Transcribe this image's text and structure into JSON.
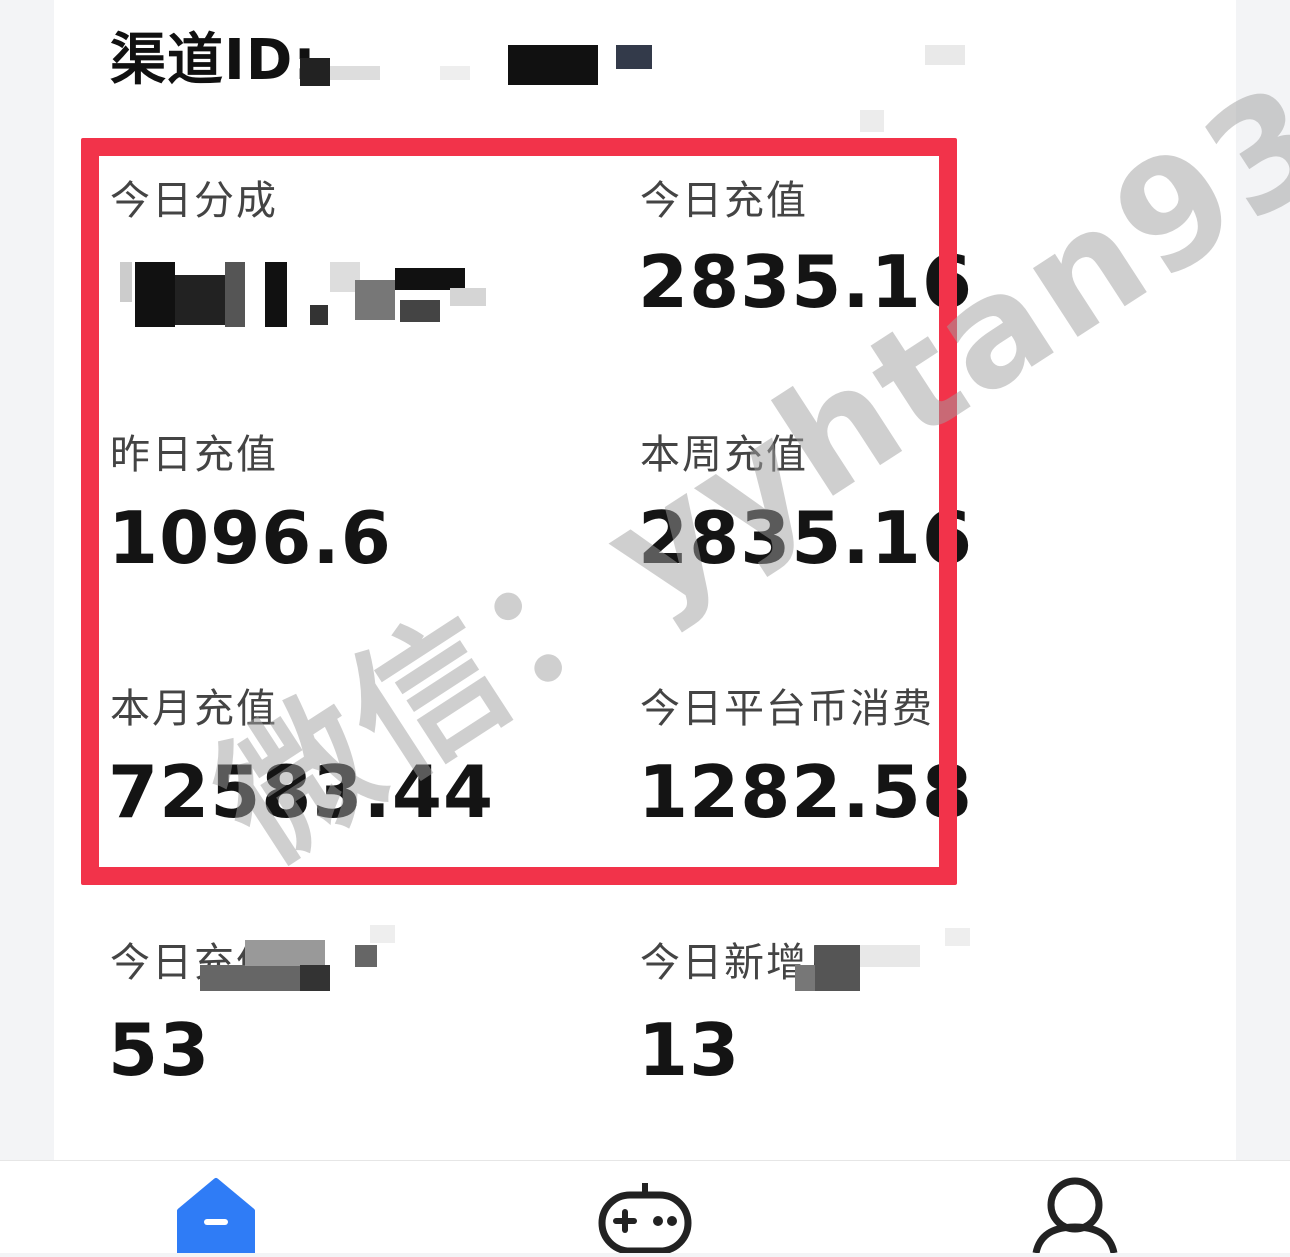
{
  "header": {
    "channel_label": "渠道ID:"
  },
  "stats": {
    "today_share_label": "今日分成",
    "today_recharge_label": "今日充值",
    "today_recharge_value": "2835.16",
    "yesterday_recharge_label": "昨日充值",
    "yesterday_recharge_value": "1096.6",
    "week_recharge_label": "本周充值",
    "week_recharge_value": "2835.16",
    "month_recharge_label": "本月充值",
    "month_recharge_value": "72583.44",
    "today_coin_consume_label": "今日平台币消费",
    "today_coin_consume_value": "1282.58",
    "today_recharge_users_label": "今日充值",
    "today_recharge_users_value": "53",
    "today_new_users_label": "今日新增用",
    "today_new_users_value": "13"
  },
  "watermark": {
    "text": "微信：yyhtan93"
  },
  "tabbar": {
    "icons": [
      "home-icon",
      "gamepad-icon",
      "user-icon"
    ],
    "accent": "#2f7cf6"
  },
  "colors": {
    "highlight_border": "#f2334a"
  }
}
